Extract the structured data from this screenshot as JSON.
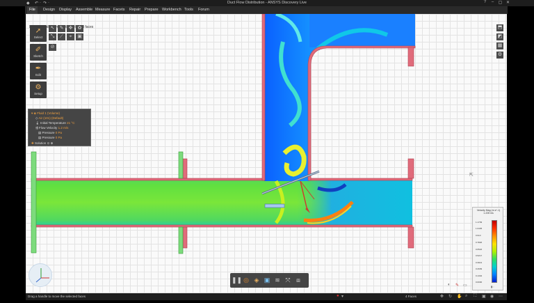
{
  "window": {
    "title": "Duct Flow Distribution - ANSYS Discovery Live",
    "quick_access": [
      "◆",
      "↶",
      "·",
      "↷",
      "·"
    ],
    "controls": [
      "?",
      "–",
      "▢",
      "✕"
    ]
  },
  "menu": [
    "File",
    "Design",
    "Display",
    "Assemble",
    "Measure",
    "Facets",
    "Repair",
    "Prepare",
    "Workbench",
    "Tools",
    "Forum"
  ],
  "canvas": {
    "hint": "Drag a handle to move the selected faces"
  },
  "tools": {
    "select": "Select",
    "sketch": "Sketch",
    "edit": "Edit",
    "setup": "Setup"
  },
  "physics": {
    "fluid": "Fluid 1 (Volume)",
    "material": "Air (101) (Default)",
    "temperature_label": "Initial Temperature",
    "temperature_value": "21 °C",
    "velocity_label": "Flow Velocity",
    "velocity_value": "1.2 m/s",
    "pressure_label": "Pressure",
    "pressure_value": "0 Pa",
    "pressure2_label": "Pressure",
    "pressure2_value": "0 Pa",
    "solution_label": "Solution"
  },
  "legend": {
    "title": "Velocity Mag (m s^-1)",
    "subtitle": "1.228 ms",
    "ticks": [
      "1.1739",
      "1.0435",
      "0.913",
      "0.7826",
      "0.6522",
      "0.5217",
      "0.3913",
      "0.2609",
      "0.1304",
      "0.0000"
    ]
  },
  "status": {
    "message": "Drag a handle to move the selected faces",
    "selection": "4 Faces"
  },
  "colors": {
    "pipe_wall": "#e06b7b",
    "inlet_flange": "#7ddb7d",
    "accent": "#f0a040"
  }
}
